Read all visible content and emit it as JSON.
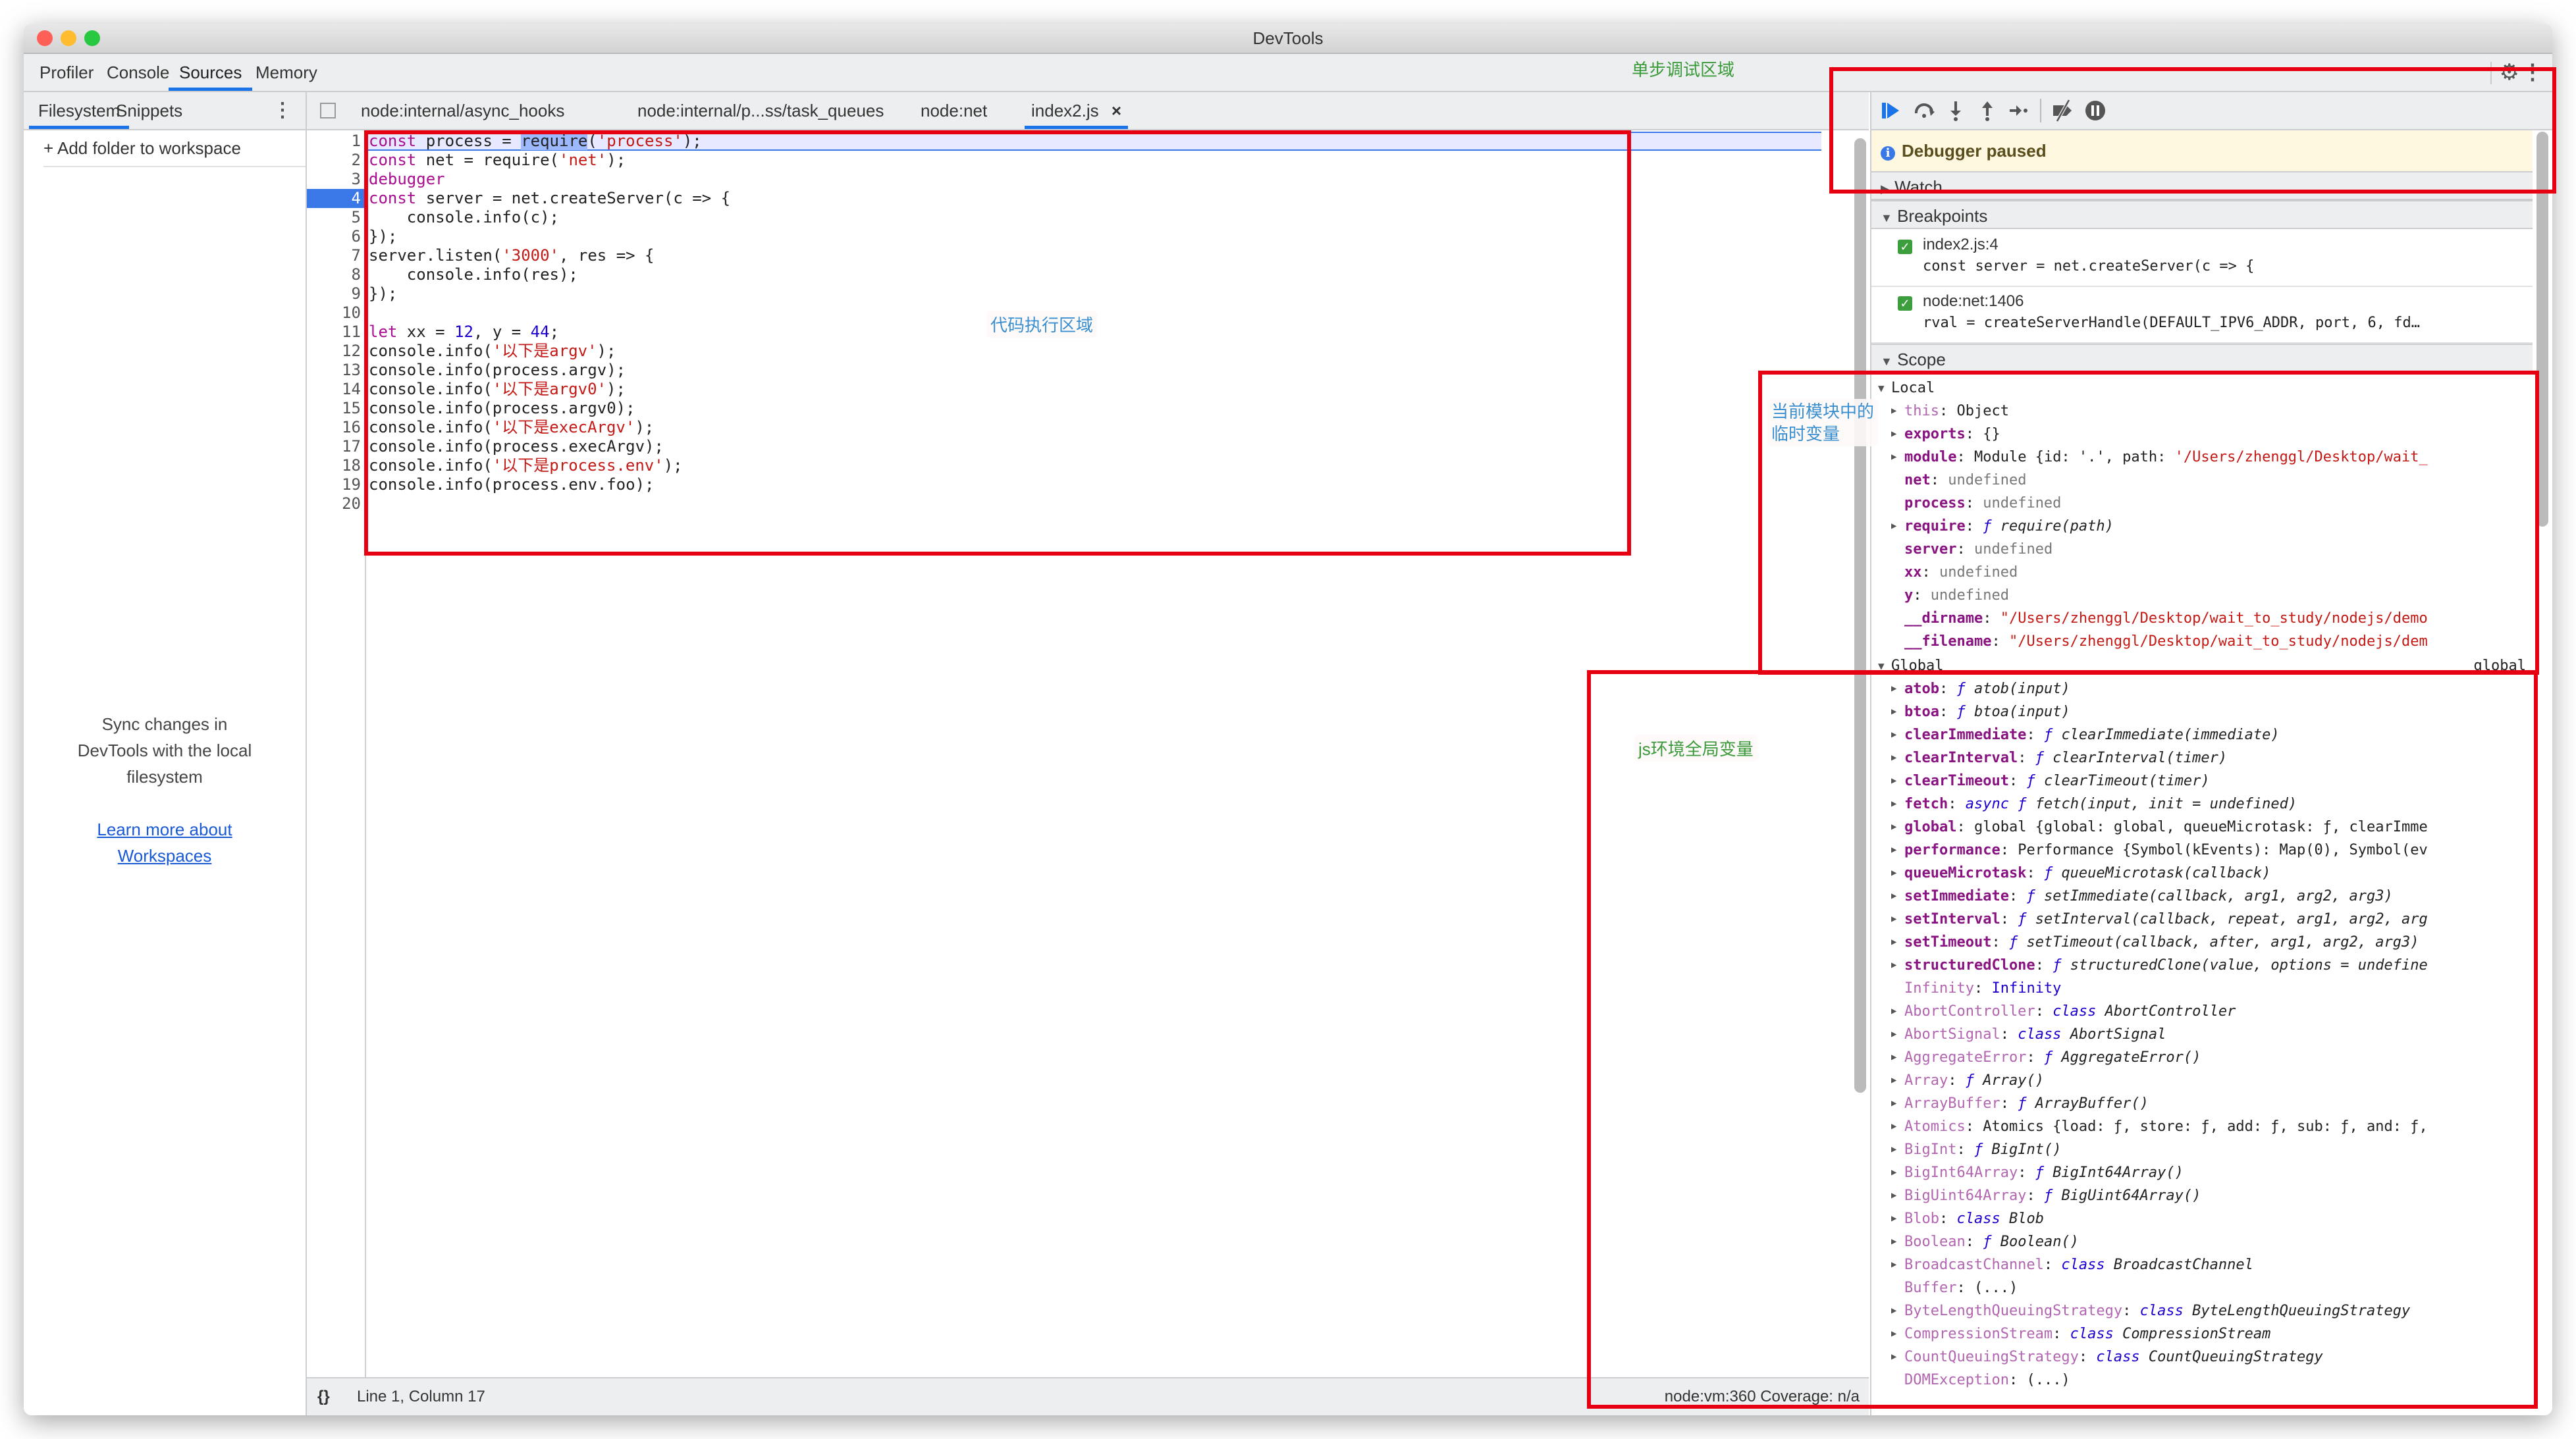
{
  "window": {
    "title": "DevTools",
    "traffic_lights": [
      {
        "name": "close",
        "color": "#fe5f57"
      },
      {
        "name": "minimize",
        "color": "#febc2e"
      },
      {
        "name": "zoom",
        "color": "#28c840"
      }
    ]
  },
  "main_tabs": [
    {
      "label": "Profiler",
      "active": false
    },
    {
      "label": "Console",
      "active": false
    },
    {
      "label": "Sources",
      "active": true
    },
    {
      "label": "Memory",
      "active": false
    }
  ],
  "top_right_icons": [
    "gear-icon",
    "more-vertical-icon"
  ],
  "sidebar": {
    "tabs": [
      {
        "label": "Filesystem",
        "active": true
      },
      {
        "label": "Snippets",
        "active": false
      }
    ],
    "more_icon": "⋮",
    "add_folder_label": "+ Add folder to workspace",
    "sync_text_lines": [
      "Sync changes in",
      "DevTools with the local",
      "filesystem"
    ],
    "learn_more_lines": [
      "Learn more about",
      "Workspaces"
    ]
  },
  "file_tabs": [
    {
      "label": "node:internal/async_hooks",
      "active": false
    },
    {
      "label": "node:internal/p...ss/task_queues",
      "active": false
    },
    {
      "label": "node:net",
      "active": false
    },
    {
      "label": "index2.js",
      "active": true,
      "closable": true
    }
  ],
  "close_glyph": "×",
  "code": {
    "current_line": 1,
    "breakpoint_line": 4,
    "lines": [
      {
        "n": "1",
        "tokens": [
          [
            "kw",
            "const"
          ],
          [
            "",
            " process = "
          ],
          [
            "hl",
            "require"
          ],
          [
            "",
            "("
          ],
          [
            "str",
            "'process'"
          ],
          [
            "",
            ");"
          ]
        ]
      },
      {
        "n": "2",
        "tokens": [
          [
            "kw",
            "const"
          ],
          [
            "",
            " net = require("
          ],
          [
            "str",
            "'net'"
          ],
          [
            "",
            ");"
          ]
        ]
      },
      {
        "n": "3",
        "tokens": [
          [
            "kw",
            "debugger"
          ]
        ]
      },
      {
        "n": "4",
        "tokens": [
          [
            "kw",
            "const"
          ],
          [
            "",
            " server = net.createServer(c => {"
          ]
        ]
      },
      {
        "n": "5",
        "tokens": [
          [
            "",
            "    console.info(c);"
          ]
        ]
      },
      {
        "n": "6",
        "tokens": [
          [
            "",
            "});"
          ]
        ]
      },
      {
        "n": "7",
        "tokens": [
          [
            "",
            "server.listen("
          ],
          [
            "str",
            "'3000'"
          ],
          [
            "",
            ", res => {"
          ]
        ]
      },
      {
        "n": "8",
        "tokens": [
          [
            "",
            "    console.info(res);"
          ]
        ]
      },
      {
        "n": "9",
        "tokens": [
          [
            "",
            "});"
          ]
        ]
      },
      {
        "n": "10",
        "tokens": []
      },
      {
        "n": "11",
        "tokens": [
          [
            "kw",
            "let"
          ],
          [
            "",
            " xx = "
          ],
          [
            "num",
            "12"
          ],
          [
            "",
            ", y = "
          ],
          [
            "num",
            "44"
          ],
          [
            "",
            ";"
          ]
        ]
      },
      {
        "n": "12",
        "tokens": [
          [
            "",
            "console.info("
          ],
          [
            "str",
            "'以下是argv'"
          ],
          [
            "",
            ");"
          ]
        ]
      },
      {
        "n": "13",
        "tokens": [
          [
            "",
            "console.info(process.argv);"
          ]
        ]
      },
      {
        "n": "14",
        "tokens": [
          [
            "",
            "console.info("
          ],
          [
            "str",
            "'以下是argv0'"
          ],
          [
            "",
            ");"
          ]
        ]
      },
      {
        "n": "15",
        "tokens": [
          [
            "",
            "console.info(process.argv0);"
          ]
        ]
      },
      {
        "n": "16",
        "tokens": [
          [
            "",
            "console.info("
          ],
          [
            "str",
            "'以下是execArgv'"
          ],
          [
            "",
            ");"
          ]
        ]
      },
      {
        "n": "17",
        "tokens": [
          [
            "",
            "console.info(process.execArgv);"
          ]
        ]
      },
      {
        "n": "18",
        "tokens": [
          [
            "",
            "console.info("
          ],
          [
            "str",
            "'以下是process.env'"
          ],
          [
            "",
            ");"
          ]
        ]
      },
      {
        "n": "19",
        "tokens": [
          [
            "",
            "console.info(process.env.foo);"
          ]
        ]
      },
      {
        "n": "20",
        "tokens": []
      }
    ]
  },
  "status_bar": {
    "format_icon": "{}",
    "position": "Line 1, Column 17",
    "right_text": "node:vm:360 Coverage: n/a"
  },
  "debugger_toolbar": {
    "buttons": [
      {
        "name": "resume-button",
        "glyph": "▶",
        "active": true
      },
      {
        "name": "step-over-button",
        "glyph": "↷"
      },
      {
        "name": "step-into-button",
        "glyph": "↓"
      },
      {
        "name": "step-out-button",
        "glyph": "↑"
      },
      {
        "name": "step-button",
        "glyph": "→•"
      },
      {
        "name": "deactivate-breakpoints-button",
        "glyph": "⧸"
      },
      {
        "name": "pause-on-exceptions-button",
        "glyph": "⏸"
      }
    ]
  },
  "paused_banner": "Debugger paused",
  "sections": {
    "watch": "Watch",
    "breakpoints": "Breakpoints",
    "scope": "Scope"
  },
  "breakpoints": [
    {
      "location": "index2.js:4",
      "code": "const server = net.createServer(c => {",
      "checked": true
    },
    {
      "location": "node:net:1406",
      "code": "rval = createServerHandle(DEFAULT_IPV6_ADDR, port, 6, fd…",
      "checked": true
    }
  ],
  "scope": {
    "local": {
      "label": "Local",
      "items": [
        {
          "key": "this",
          "value": "Object",
          "expandable": true,
          "kind": "plain",
          "np": true
        },
        {
          "key": "exports",
          "value": "{}",
          "expandable": true,
          "kind": "plain"
        },
        {
          "key": "module",
          "value": "Module {id: '.', path: ",
          "value_str": "'/Users/zhenggl/Desktop/wait_",
          "expandable": true,
          "kind": "plain"
        },
        {
          "key": "net",
          "value": "undefined",
          "expandable": false,
          "kind": "undef"
        },
        {
          "key": "process",
          "value": "undefined",
          "expandable": false,
          "kind": "undef"
        },
        {
          "key": "require",
          "value": "require(path)",
          "expandable": true,
          "kind": "fn"
        },
        {
          "key": "server",
          "value": "undefined",
          "expandable": false,
          "kind": "undef"
        },
        {
          "key": "xx",
          "value": "undefined",
          "expandable": false,
          "kind": "undef"
        },
        {
          "key": "y",
          "value": "undefined",
          "expandable": false,
          "kind": "undef"
        },
        {
          "key": "__dirname",
          "value": "",
          "value_str": "\"/Users/zhenggl/Desktop/wait_to_study/nodejs/demo",
          "expandable": false,
          "kind": "plain"
        },
        {
          "key": "__filename",
          "value": "",
          "value_str": "\"/Users/zhenggl/Desktop/wait_to_study/nodejs/dem",
          "expandable": false,
          "kind": "plain"
        }
      ]
    },
    "global": {
      "label": "Global",
      "right_label": "global",
      "items": [
        {
          "key": "atob",
          "value": "atob(input)",
          "expandable": true,
          "kind": "fn"
        },
        {
          "key": "btoa",
          "value": "btoa(input)",
          "expandable": true,
          "kind": "fn"
        },
        {
          "key": "clearImmediate",
          "value": "clearImmediate(immediate)",
          "expandable": true,
          "kind": "fn"
        },
        {
          "key": "clearInterval",
          "value": "clearInterval(timer)",
          "expandable": true,
          "kind": "fn"
        },
        {
          "key": "clearTimeout",
          "value": "clearTimeout(timer)",
          "expandable": true,
          "kind": "fn"
        },
        {
          "key": "fetch",
          "value": "fetch(input, init = undefined)",
          "prefix": "async",
          "expandable": true,
          "kind": "fn"
        },
        {
          "key": "global",
          "value": "global {global: global, queueMicrotask: ƒ, clearImme",
          "expandable": true,
          "kind": "plain"
        },
        {
          "key": "performance",
          "value": "Performance {Symbol(kEvents): Map(0), Symbol(ev",
          "expandable": true,
          "kind": "plain"
        },
        {
          "key": "queueMicrotask",
          "value": "queueMicrotask(callback)",
          "expandable": true,
          "kind": "fn"
        },
        {
          "key": "setImmediate",
          "value": "setImmediate(callback, arg1, arg2, arg3)",
          "expandable": true,
          "kind": "fn"
        },
        {
          "key": "setInterval",
          "value": "setInterval(callback, repeat, arg1, arg2, arg",
          "expandable": true,
          "kind": "fn"
        },
        {
          "key": "setTimeout",
          "value": "setTimeout(callback, after, arg1, arg2, arg3)",
          "expandable": true,
          "kind": "fn"
        },
        {
          "key": "structuredClone",
          "value": "structuredClone(value, options = undefine",
          "expandable": true,
          "kind": "fn"
        },
        {
          "key": "Infinity",
          "value": "Infinity",
          "expandable": false,
          "kind": "num",
          "np": true
        },
        {
          "key": "AbortController",
          "value": "AbortController",
          "prefix": "class",
          "expandable": true,
          "kind": "fn",
          "np": true
        },
        {
          "key": "AbortSignal",
          "value": "AbortSignal",
          "prefix": "class",
          "expandable": true,
          "kind": "fn",
          "np": true
        },
        {
          "key": "AggregateError",
          "value": "AggregateError()",
          "expandable": true,
          "kind": "fn",
          "np": true
        },
        {
          "key": "Array",
          "value": "Array()",
          "expandable": true,
          "kind": "fn",
          "np": true
        },
        {
          "key": "ArrayBuffer",
          "value": "ArrayBuffer()",
          "expandable": true,
          "kind": "fn",
          "np": true
        },
        {
          "key": "Atomics",
          "value": "Atomics {load: ƒ, store: ƒ, add: ƒ, sub: ƒ, and: ƒ,",
          "expandable": true,
          "kind": "plain",
          "np": true
        },
        {
          "key": "BigInt",
          "value": "BigInt()",
          "expandable": true,
          "kind": "fn",
          "np": true
        },
        {
          "key": "BigInt64Array",
          "value": "BigInt64Array()",
          "expandable": true,
          "kind": "fn",
          "np": true
        },
        {
          "key": "BigUint64Array",
          "value": "BigUint64Array()",
          "expandable": true,
          "kind": "fn",
          "np": true
        },
        {
          "key": "Blob",
          "value": "Blob",
          "prefix": "class",
          "expandable": true,
          "kind": "fn",
          "np": true
        },
        {
          "key": "Boolean",
          "value": "Boolean()",
          "expandable": true,
          "kind": "fn",
          "np": true
        },
        {
          "key": "BroadcastChannel",
          "value": "BroadcastChannel",
          "prefix": "class",
          "expandable": true,
          "kind": "fn",
          "np": true
        },
        {
          "key": "Buffer",
          "value": "(...)",
          "expandable": false,
          "kind": "plain",
          "np": true
        },
        {
          "key": "ByteLengthQueuingStrategy",
          "value": "ByteLengthQueuingStrategy",
          "prefix": "class",
          "expandable": true,
          "kind": "fn",
          "np": true
        },
        {
          "key": "CompressionStream",
          "value": "CompressionStream",
          "prefix": "class",
          "expandable": true,
          "kind": "fn",
          "np": true
        },
        {
          "key": "CountQueuingStrategy",
          "value": "CountQueuingStrategy",
          "prefix": "class",
          "expandable": true,
          "kind": "fn",
          "np": true
        },
        {
          "key": "DOMException",
          "value": "(...)",
          "expandable": false,
          "kind": "plain",
          "np": true
        }
      ]
    }
  },
  "annotations": {
    "step_debug_area": {
      "text": "单步调试区域",
      "color": "#3a9a3a"
    },
    "code_exec_area": {
      "text": "代码执行区域",
      "color": "#3a8fd0"
    },
    "local_vars": {
      "lines": [
        "当前模块中的",
        "临时变量"
      ],
      "color": "#3a8fd0"
    },
    "global_vars": {
      "text": "js环境全局变量",
      "color": "#3a9a3a"
    },
    "box_color": "#e60012"
  }
}
